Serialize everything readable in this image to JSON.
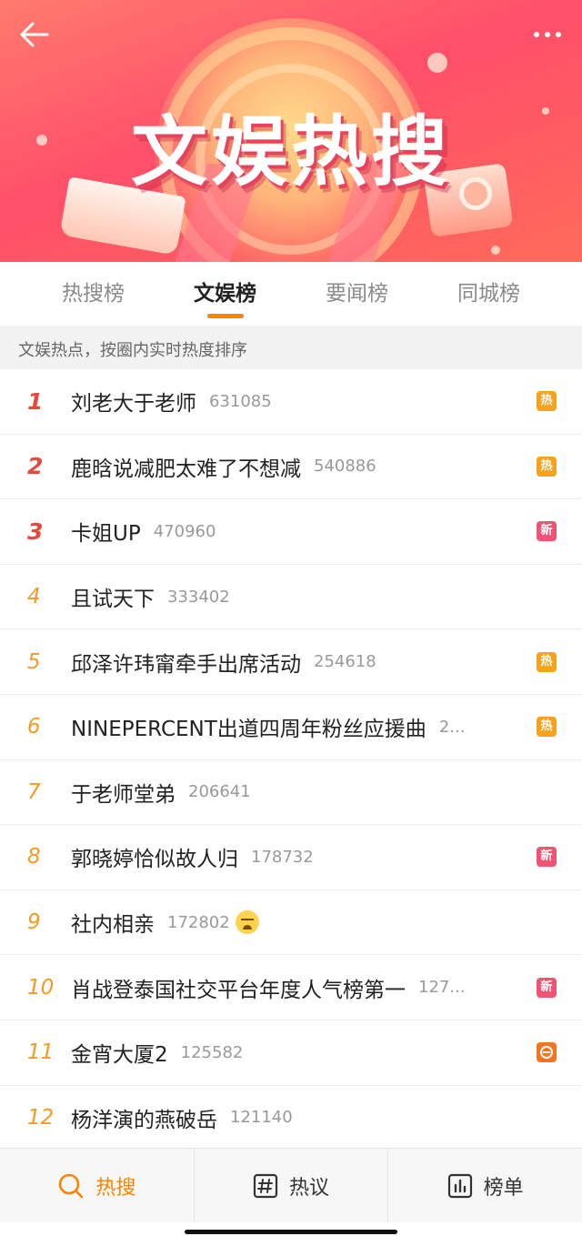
{
  "banner": {
    "title": "文娱热搜",
    "colors": {
      "accent": "#ff8200",
      "hot": "#f7a21b",
      "new": "#ee5575",
      "boil": "#f4751d"
    }
  },
  "tabs": [
    {
      "label": "热搜榜",
      "active": false
    },
    {
      "label": "文娱榜",
      "active": true
    },
    {
      "label": "要闻榜",
      "active": false
    },
    {
      "label": "同城榜",
      "active": false
    }
  ],
  "subtitle": "文娱热点，按圈内实时热度排序",
  "list": [
    {
      "rank": "1",
      "title": "刘老大于老师",
      "count": "631085",
      "badge": "热",
      "badge_type": "hot"
    },
    {
      "rank": "2",
      "title": "鹿晗说减肥太难了不想减",
      "count": "540886",
      "badge": "热",
      "badge_type": "hot"
    },
    {
      "rank": "3",
      "title": "卡姐UP",
      "count": "470960",
      "badge": "新",
      "badge_type": "new"
    },
    {
      "rank": "4",
      "title": "且试天下",
      "count": "333402",
      "badge": "",
      "badge_type": ""
    },
    {
      "rank": "5",
      "title": "邱泽许玮甯牵手出席活动",
      "count": "254618",
      "badge": "热",
      "badge_type": "hot"
    },
    {
      "rank": "6",
      "title": "NINEPERCENT出道四周年粉丝应援曲",
      "count": "2...",
      "badge": "热",
      "badge_type": "hot"
    },
    {
      "rank": "7",
      "title": "于老师堂弟",
      "count": "206641",
      "badge": "",
      "badge_type": ""
    },
    {
      "rank": "8",
      "title": "郭晓婷恰似故人归",
      "count": "178732",
      "badge": "新",
      "badge_type": "new"
    },
    {
      "rank": "9",
      "title": "社内相亲",
      "count": "172802",
      "badge": "",
      "badge_type": "",
      "emoji": "crying-face-icon"
    },
    {
      "rank": "10",
      "title": "肖战登泰国社交平台年度人气榜第一",
      "count": "127...",
      "badge": "新",
      "badge_type": "new"
    },
    {
      "rank": "11",
      "title": "金宵大厦2",
      "count": "125582",
      "badge": "",
      "badge_type": "boil"
    },
    {
      "rank": "12",
      "title": "杨洋演的燕破岳",
      "count": "121140",
      "badge": "",
      "badge_type": ""
    }
  ],
  "bottom_nav": [
    {
      "label": "热搜",
      "icon": "search-icon",
      "active": true
    },
    {
      "label": "热议",
      "icon": "hashtag-icon",
      "active": false
    },
    {
      "label": "榜单",
      "icon": "chart-icon",
      "active": false
    }
  ]
}
